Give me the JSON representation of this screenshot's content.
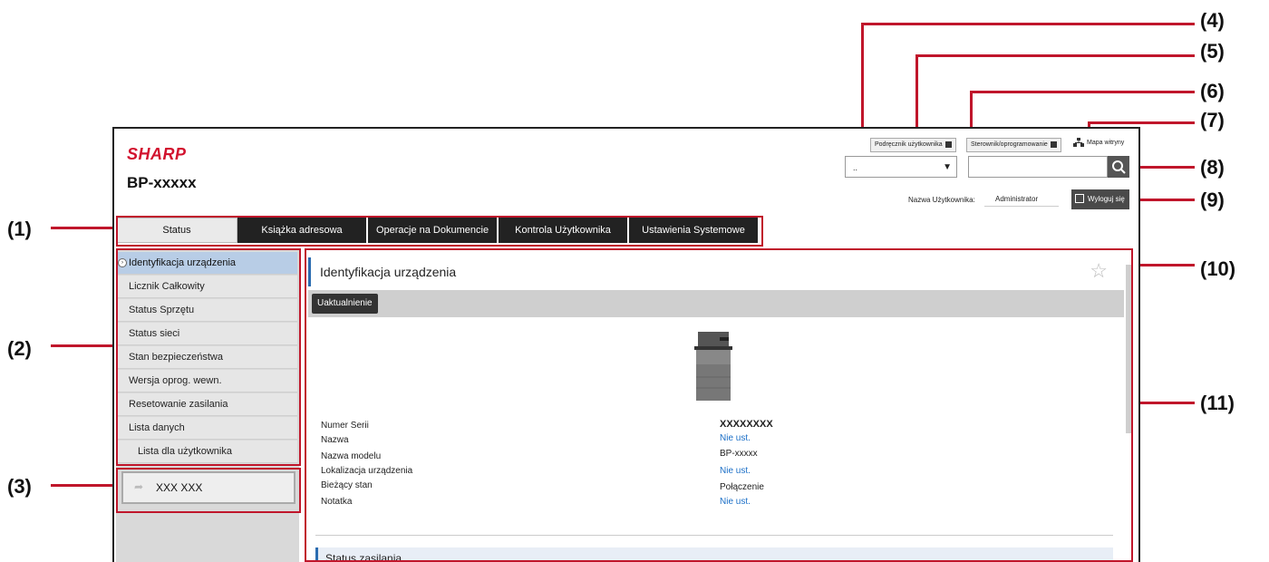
{
  "callouts": [
    "(1)",
    "(2)",
    "(3)",
    "(4)",
    "(5)",
    "(6)",
    "(7)",
    "(8)",
    "(9)",
    "(10)",
    "(11)"
  ],
  "header": {
    "logo": "SHARP",
    "model": "BP-xxxxx",
    "manual_link": "Podręcznik użytkownika",
    "driver_link": "Sterownik/oprogramowanie",
    "sitemap_link": "Mapa witryny",
    "select_value": "..",
    "user_label": "Nazwa Użytkownika:",
    "user_value": "Administrator",
    "logout_label": "Wyloguj się"
  },
  "tabs": [
    {
      "label": "Status"
    },
    {
      "label": "Książka adresowa"
    },
    {
      "label": "Operacje na Dokumencie"
    },
    {
      "label": "Kontrola Użytkownika"
    },
    {
      "label": "Ustawienia Systemowe"
    }
  ],
  "sidebar": {
    "items": [
      {
        "label": "Identyfikacja urządzenia"
      },
      {
        "label": "Licznik Całkowity"
      },
      {
        "label": "Status Sprzętu"
      },
      {
        "label": "Status sieci"
      },
      {
        "label": "Stan bezpieczeństwa"
      },
      {
        "label": "Wersja oprog. wewn."
      },
      {
        "label": "Resetowanie zasilania"
      },
      {
        "label": "Lista danych"
      },
      {
        "label": "Lista dla użytkownika"
      }
    ],
    "custom_link": "XXX XXX"
  },
  "main": {
    "title": "Identyfikacja urządzenia",
    "update_button": "Uaktualnienie",
    "fields": [
      {
        "label": "Numer Serii",
        "value": "XXXXXXXX"
      },
      {
        "label": "Nazwa",
        "value": "Nie ust."
      },
      {
        "label": "Nazwa modelu",
        "value": "BP-xxxxx"
      },
      {
        "label": "Lokalizacja urządzenia",
        "value": "Nie ust."
      },
      {
        "label": "Bieżący stan",
        "value": "Połączenie"
      },
      {
        "label": "Notatka",
        "value": "Nie ust."
      }
    ],
    "section_title": "Status zasilania"
  },
  "colors": {
    "brand": "#d2122e",
    "callout": "#c0162b",
    "link": "#1b6fc7",
    "active_menu": "#b8cde6"
  }
}
